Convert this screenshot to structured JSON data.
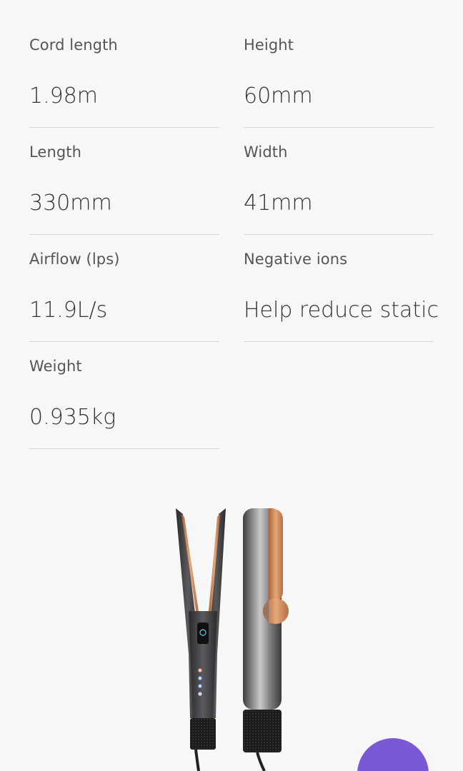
{
  "specs": [
    {
      "label": "Cord length",
      "value": "1.98m"
    },
    {
      "label": "Height",
      "value": "60mm"
    },
    {
      "label": "Length",
      "value": "330mm"
    },
    {
      "label": "Width",
      "value": "41mm"
    },
    {
      "label": "Airflow (lps)",
      "value": "11.9L/s"
    },
    {
      "label": "Negative ions",
      "value": "Help reduce static"
    },
    {
      "label": "Weight",
      "value": "0.935kg"
    }
  ],
  "colors": {
    "background": "#f7f7f7",
    "label": "#555555",
    "value": "#333333",
    "divider": "#d6d6d6",
    "chat_button": "#7b58d6",
    "copper": "#d9905e",
    "nickel": "#9a9a9a"
  },
  "icons": {
    "chat": "chat-bubble-icon",
    "product": "hair-straightener-image"
  }
}
